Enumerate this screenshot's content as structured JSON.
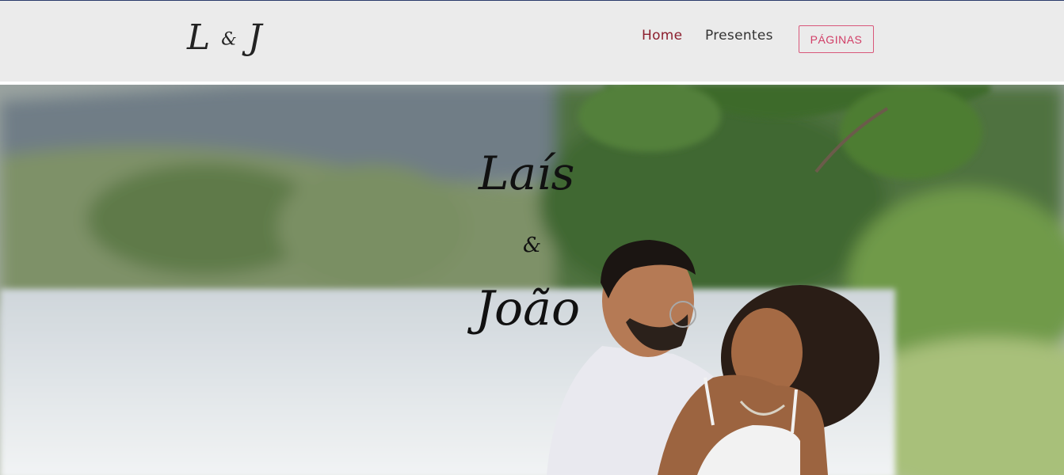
{
  "header": {
    "logo_left": "L",
    "logo_amp": "&",
    "logo_right": "J"
  },
  "nav": {
    "home": "Home",
    "presentes": "Presentes",
    "paginas_button": "PÁGINAS"
  },
  "hero": {
    "name_1": "Laís",
    "ampersand": "&",
    "name_2": "João"
  }
}
